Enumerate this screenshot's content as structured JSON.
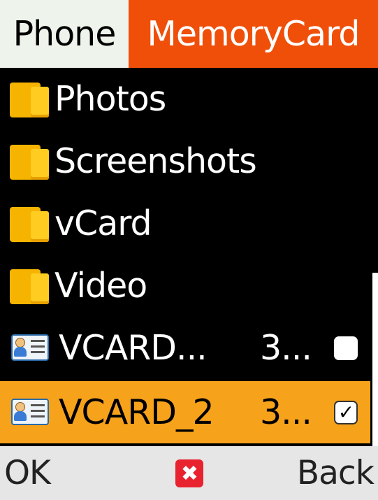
{
  "tabs": {
    "phone": "Phone",
    "memorycard": "MemoryCard",
    "active": "memorycard"
  },
  "folders": [
    {
      "name": "Photos"
    },
    {
      "name": "Screenshots"
    },
    {
      "name": "vCard"
    },
    {
      "name": "Video"
    }
  ],
  "files": [
    {
      "name": "VCARD...",
      "size": "3...",
      "checked": false,
      "selected": false
    },
    {
      "name": "VCARD_2",
      "size": "3...",
      "checked": true,
      "selected": true
    }
  ],
  "softkeys": {
    "left": "OK",
    "center_icon": "close-icon",
    "center_glyph": "✖",
    "right": "Back"
  },
  "colors": {
    "tab_active": "#f04f0a",
    "tab_inactive": "#eef3ec",
    "selection": "#f7a21b",
    "folder": "#ffcc22",
    "softkey_bar": "#e6e6e6",
    "center_key": "#e8232f"
  }
}
